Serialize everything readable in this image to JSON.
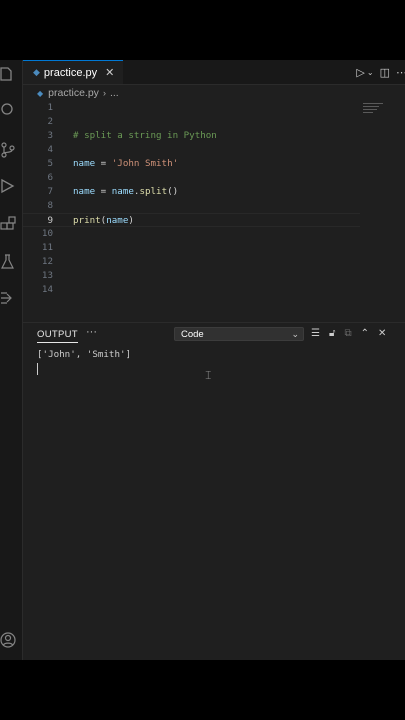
{
  "editor": {
    "tab": {
      "label": "practice.py",
      "icon": "python-file-icon",
      "close": "✕"
    },
    "breadcrumbs": {
      "file": "practice.py",
      "separator": "›",
      "more": "..."
    },
    "current_line": 9,
    "lines": [
      {
        "n": "1"
      },
      {
        "n": "2"
      },
      {
        "n": "3",
        "comment": "# split a string in Python"
      },
      {
        "n": "4"
      },
      {
        "n": "5",
        "var": "name",
        "op": " = ",
        "str": "'John Smith'"
      },
      {
        "n": "6"
      },
      {
        "n": "7",
        "var": "name",
        "op": " = ",
        "var2": "name",
        "punc": ".",
        "fn": "split",
        "punc2": "()"
      },
      {
        "n": "8"
      },
      {
        "n": "9",
        "fn": "print",
        "punc": "(",
        "var": "name",
        "punc2": ")"
      },
      {
        "n": "10"
      },
      {
        "n": "11"
      },
      {
        "n": "12"
      },
      {
        "n": "13"
      },
      {
        "n": "14"
      }
    ]
  },
  "panel": {
    "title": "OUTPUT",
    "more": "···",
    "channel": "Code",
    "output_text": "['John', 'Smith']"
  },
  "colors": {
    "accent": "#0078d4",
    "comment": "#6a9955",
    "variable": "#9cdcfe",
    "string": "#ce9178",
    "function": "#dcdcaa"
  }
}
